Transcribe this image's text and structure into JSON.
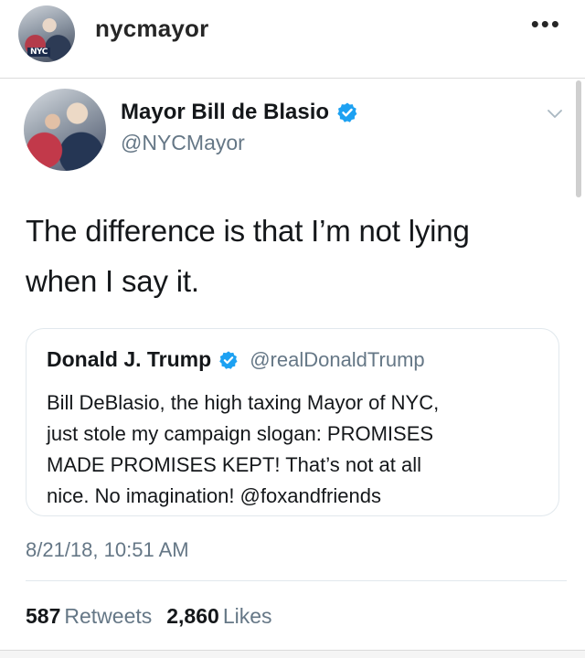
{
  "post": {
    "username": "nycmayor",
    "more_icon": "•••",
    "avatar_badge": "NYC"
  },
  "tweet": {
    "display_name": "Mayor Bill de Blasio",
    "handle": "@NYCMayor",
    "text_line1": "The difference is that I’m not lying",
    "text_line2": "when I say it.",
    "quoted": {
      "display_name": "Donald J. Trump",
      "handle": "@realDonaldTrump",
      "body": "Bill DeBlasio, the high taxing Mayor of NYC,\njust stole my campaign slogan: PROMISES\nMADE  PROMISES KEPT! That’s not at all\nnice. No imagination! @foxandfriends"
    },
    "timestamp": "8/21/18, 10:51 AM",
    "retweets_count": "587",
    "retweets_label": "Retweets",
    "likes_count": "2,860",
    "likes_label": "Likes"
  },
  "colors": {
    "verified_blue": "#1da1f2",
    "secondary_text": "#657786",
    "border": "#e1e8ed"
  },
  "icons": {
    "verified": "verified-badge-icon",
    "chevron": "chevron-down-icon",
    "more": "more-options-icon"
  }
}
